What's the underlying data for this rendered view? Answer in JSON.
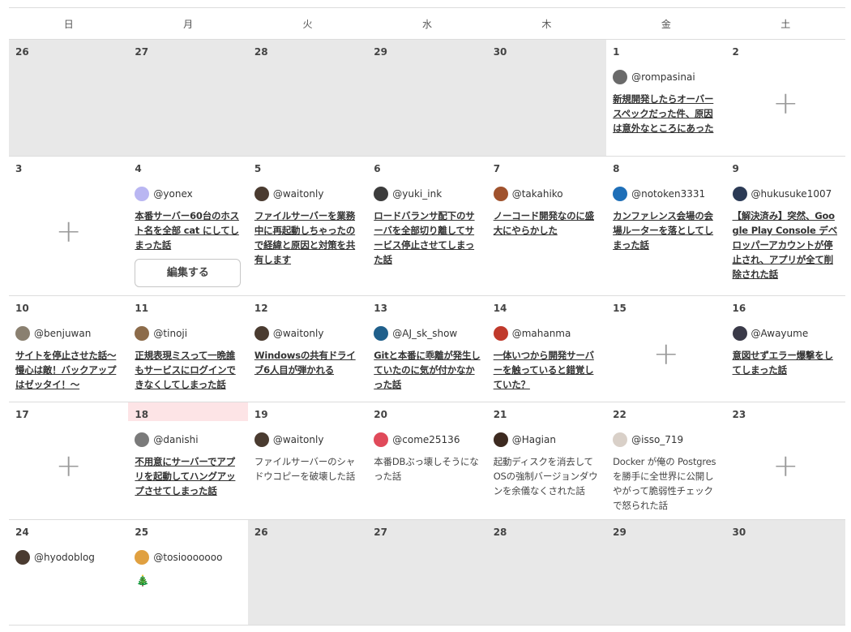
{
  "weekdays": [
    "日",
    "月",
    "火",
    "水",
    "木",
    "金",
    "土"
  ],
  "edit_label": "編集する",
  "add_label": "+",
  "weeks": [
    [
      {
        "day": "26",
        "other": true
      },
      {
        "day": "27",
        "other": true
      },
      {
        "day": "28",
        "other": true
      },
      {
        "day": "29",
        "other": true
      },
      {
        "day": "30",
        "other": true
      },
      {
        "day": "1",
        "user": "@rompasinai",
        "avatar": "#6a6a6a",
        "title": "新規開発したらオーバースペックだった件、原因は意外なところにあった"
      },
      {
        "day": "2",
        "empty": true
      }
    ],
    [
      {
        "day": "3",
        "empty": true
      },
      {
        "day": "4",
        "user": "@yonex",
        "avatar": "#b9b6f2",
        "title": "本番サーバー60台のホスト名を全部 cat にしてしまった話",
        "edit": true
      },
      {
        "day": "5",
        "user": "@waitonly",
        "avatar": "#4a3b30",
        "title": "ファイルサーバーを業務中に再起動しちゃったので経緯と原因と対策を共有します"
      },
      {
        "day": "6",
        "user": "@yuki_ink",
        "avatar": "#3c3c3c",
        "title": "ロードバランサ配下のサーバを全部切り離してサービス停止させてしまった話"
      },
      {
        "day": "7",
        "user": "@takahiko",
        "avatar": "#a0522d",
        "title": "ノーコード開発なのに盛大にやらかした"
      },
      {
        "day": "8",
        "user": "@notoken3331",
        "avatar": "#1e6fb8",
        "title": "カンファレンス会場の会場ルーターを落としてしまった話"
      },
      {
        "day": "9",
        "user": "@hukusuke1007",
        "avatar": "#2b3a55",
        "title": "【解決済み】突然、Google Play Console デベロッパーアカウントが停止され、アプリが全て削除された話"
      }
    ],
    [
      {
        "day": "10",
        "user": "@benjuwan",
        "avatar": "#8a8070",
        "title": "サイトを停止させた話〜慢心は敵！バックアップはゼッタイ！〜"
      },
      {
        "day": "11",
        "user": "@tinoji",
        "avatar": "#8c6b4a",
        "title": "正規表現ミスって一晩誰もサービスにログインできなくしてしまった話"
      },
      {
        "day": "12",
        "user": "@waitonly",
        "avatar": "#4a3b30",
        "title": "Windowsの共有ドライブ6人目が弾かれる"
      },
      {
        "day": "13",
        "user": "@AJ_sk_show",
        "avatar": "#1f5f8b",
        "title": "Gitと本番に乖離が発生していたのに気が付かなかった話"
      },
      {
        "day": "14",
        "user": "@mahanma",
        "avatar": "#c0392b",
        "title": "一体いつから開発サーバーを触っていると錯覚していた？"
      },
      {
        "day": "15",
        "empty": true
      },
      {
        "day": "16",
        "user": "@Awayume",
        "avatar": "#3a3a48",
        "title": "意図せずエラー爆撃をしてしまった話"
      }
    ],
    [
      {
        "day": "17",
        "empty": true
      },
      {
        "day": "18",
        "today": true,
        "user": "@danishi",
        "avatar": "#7a7a7a",
        "title": "不用意にサーバーでアプリを起動してハングアップさせてしまった話"
      },
      {
        "day": "19",
        "user": "@waitonly",
        "avatar": "#4a3b30",
        "title": "ファイルサーバーのシャドウコピーを破壊した話",
        "plain": true
      },
      {
        "day": "20",
        "user": "@come25136",
        "avatar": "#e04a5a",
        "title": "本番DBぶっ壊しそうになった話",
        "plain": true
      },
      {
        "day": "21",
        "user": "@Hagian",
        "avatar": "#3d2a20",
        "title": "起動ディスクを消去してOSの強制バージョンダウンを余儀なくされた話",
        "plain": true
      },
      {
        "day": "22",
        "user": "@isso_719",
        "avatar": "#d9d0c8",
        "title": "Docker が俺の Postgres を勝手に全世界に公開しやがって脆弱性チェックで怒られた話",
        "plain": true
      },
      {
        "day": "23",
        "empty": true
      }
    ],
    [
      {
        "day": "24",
        "user": "@hyodoblog",
        "avatar": "#4a3b30"
      },
      {
        "day": "25",
        "user": "@tosiooooooo",
        "avatar": "#e0a040",
        "emoji": "🎄"
      },
      {
        "day": "26",
        "other": true
      },
      {
        "day": "27",
        "other": true
      },
      {
        "day": "28",
        "other": true
      },
      {
        "day": "29",
        "other": true
      },
      {
        "day": "30",
        "other": true
      }
    ]
  ]
}
